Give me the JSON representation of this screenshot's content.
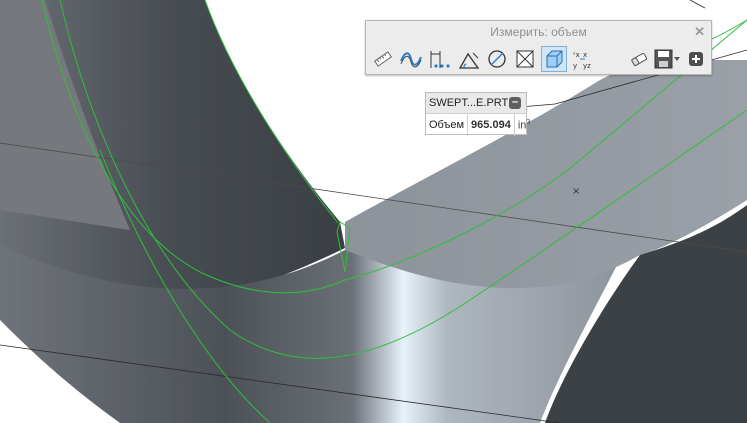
{
  "toolbar": {
    "title": "Измерить: объем",
    "close_symbol": "✕",
    "tools": [
      {
        "icon": "ruler-icon",
        "name": "measure-length-tool"
      },
      {
        "icon": "curve-wave-icon",
        "name": "measure-curve-tool"
      },
      {
        "icon": "distance-icon",
        "name": "measure-distance-tool"
      },
      {
        "icon": "angle-icon",
        "name": "measure-angle-tool"
      },
      {
        "icon": "diameter-icon",
        "name": "measure-diameter-tool"
      },
      {
        "icon": "area-icon",
        "name": "measure-area-tool"
      },
      {
        "icon": "volume-icon",
        "name": "measure-volume-tool",
        "active": true
      },
      {
        "icon": "transform-icon",
        "name": "measure-transform-tool"
      },
      {
        "icon": "eraser-icon",
        "name": "clear-measurements-tool"
      },
      {
        "icon": "save-icon",
        "name": "save-measurement-tool"
      },
      {
        "icon": "expand-plus-icon",
        "name": "expand-toolbar-tool"
      }
    ]
  },
  "result": {
    "feature_name": "SWEPT...E.PRT",
    "minimize_symbol": "–",
    "label": "Объем",
    "value": "965.094",
    "unit": "in",
    "unit_power": "3"
  },
  "colors": {
    "model_dark": "#3f4449",
    "model_light": "#8e949b",
    "highlight": "#2fbf3a",
    "background": "#ffffff"
  }
}
